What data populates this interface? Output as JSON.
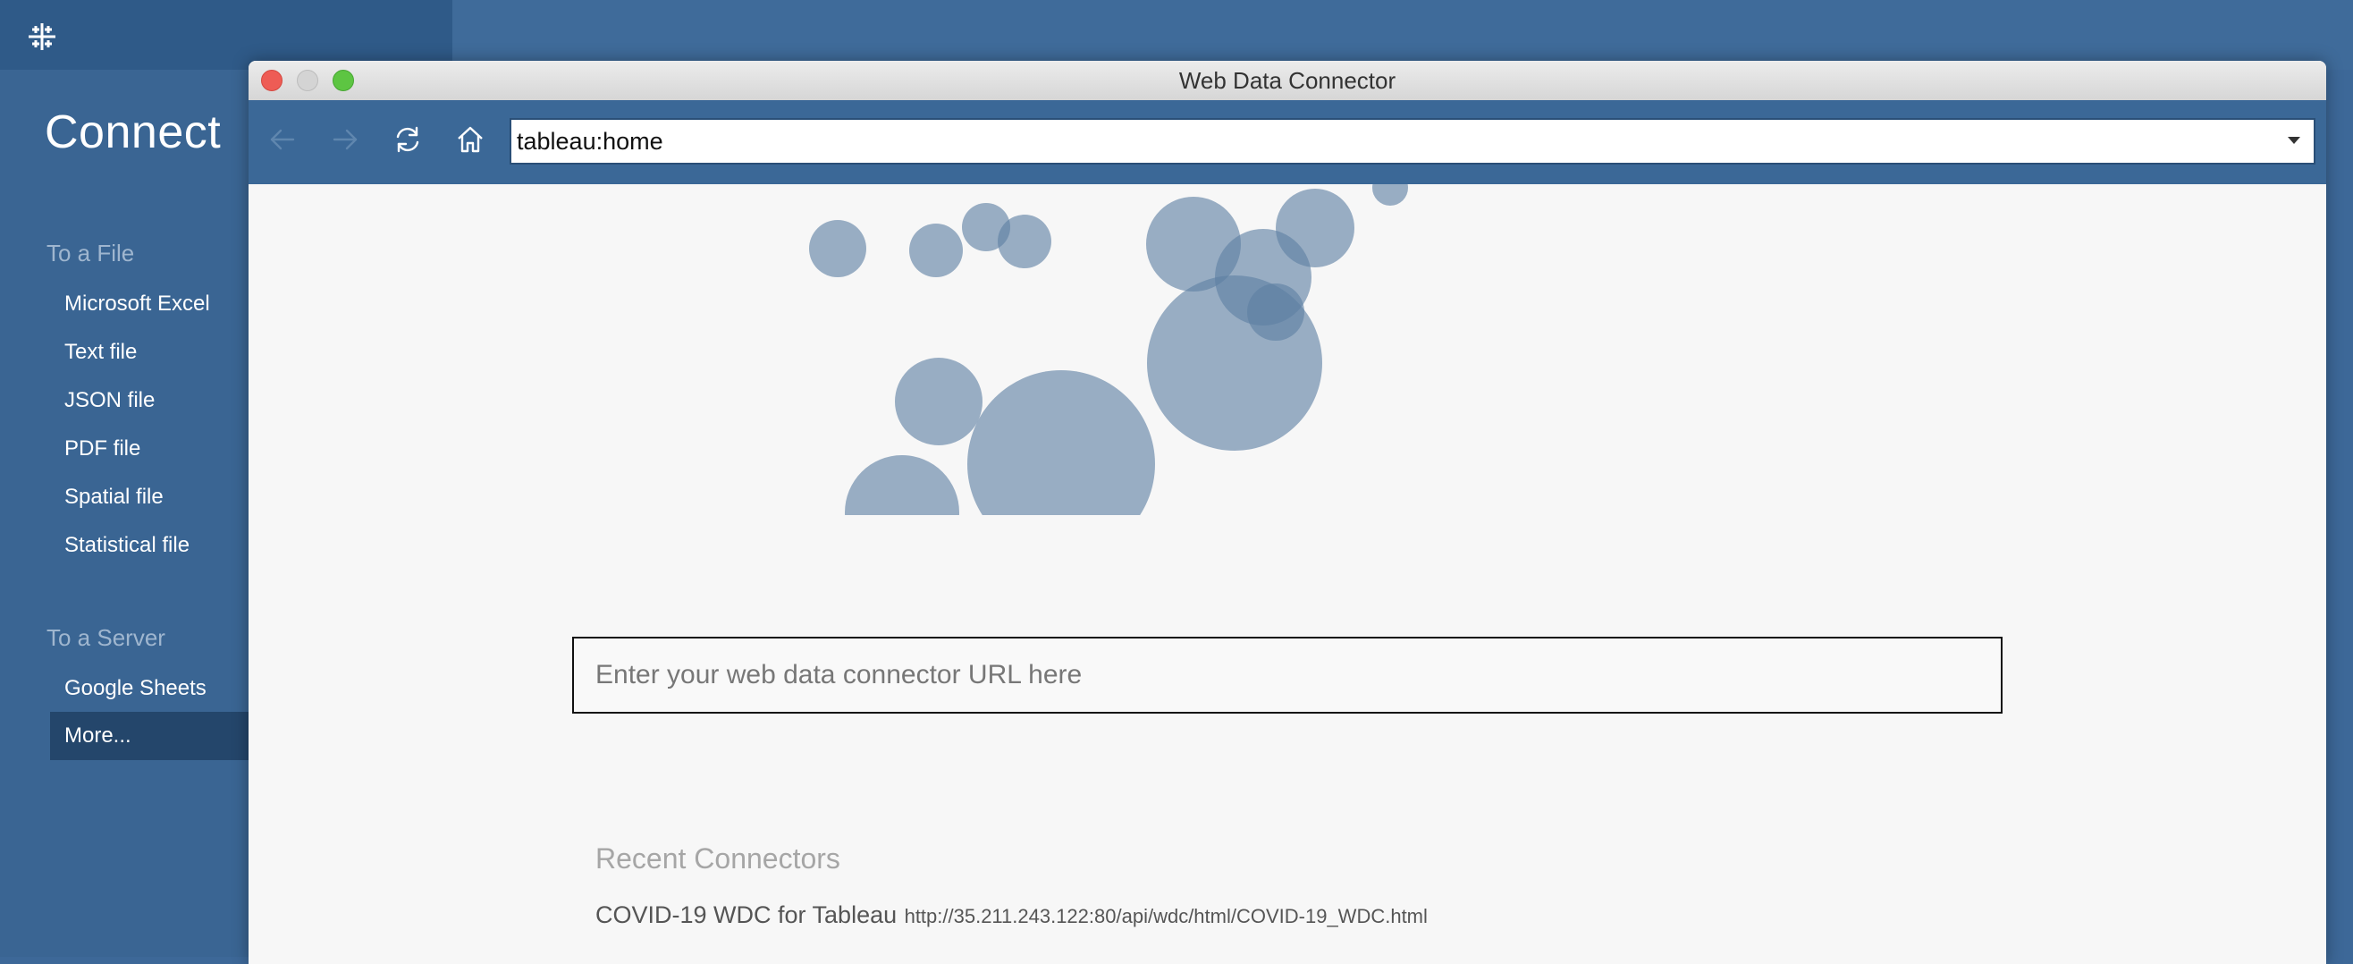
{
  "app": {
    "connect_title": "Connect",
    "sections": [
      {
        "heading": "To a File",
        "items": [
          "Microsoft Excel",
          "Text file",
          "JSON file",
          "PDF file",
          "Spatial file",
          "Statistical file"
        ]
      },
      {
        "heading": "To a Server",
        "items": [
          "Google Sheets",
          "More..."
        ]
      }
    ],
    "selected_item": "More..."
  },
  "window": {
    "title": "Web Data Connector",
    "buttons": [
      "close-icon",
      "minimize-icon",
      "maximize-icon"
    ]
  },
  "toolbar": {
    "icons": [
      "back-arrow-icon",
      "forward-arrow-icon",
      "refresh-icon",
      "home-icon"
    ],
    "url": "tableau:home",
    "dropdown_icon": "chevron-down-icon"
  },
  "content": {
    "input_placeholder": "Enter your web data connector URL here",
    "recent_heading": "Recent Connectors",
    "recent": [
      {
        "name": "COVID-19 WDC for Tableau",
        "url": "http://35.211.243.122:80/api/wdc/html/COVID-19_WDC.html"
      }
    ]
  },
  "colors": {
    "app_bg": "#3d6898",
    "sidebar_bg": "#3a6593",
    "selected_bg": "#24466b",
    "toolbar_bg": "#3b6897",
    "bubble": "#5d7fa3"
  }
}
